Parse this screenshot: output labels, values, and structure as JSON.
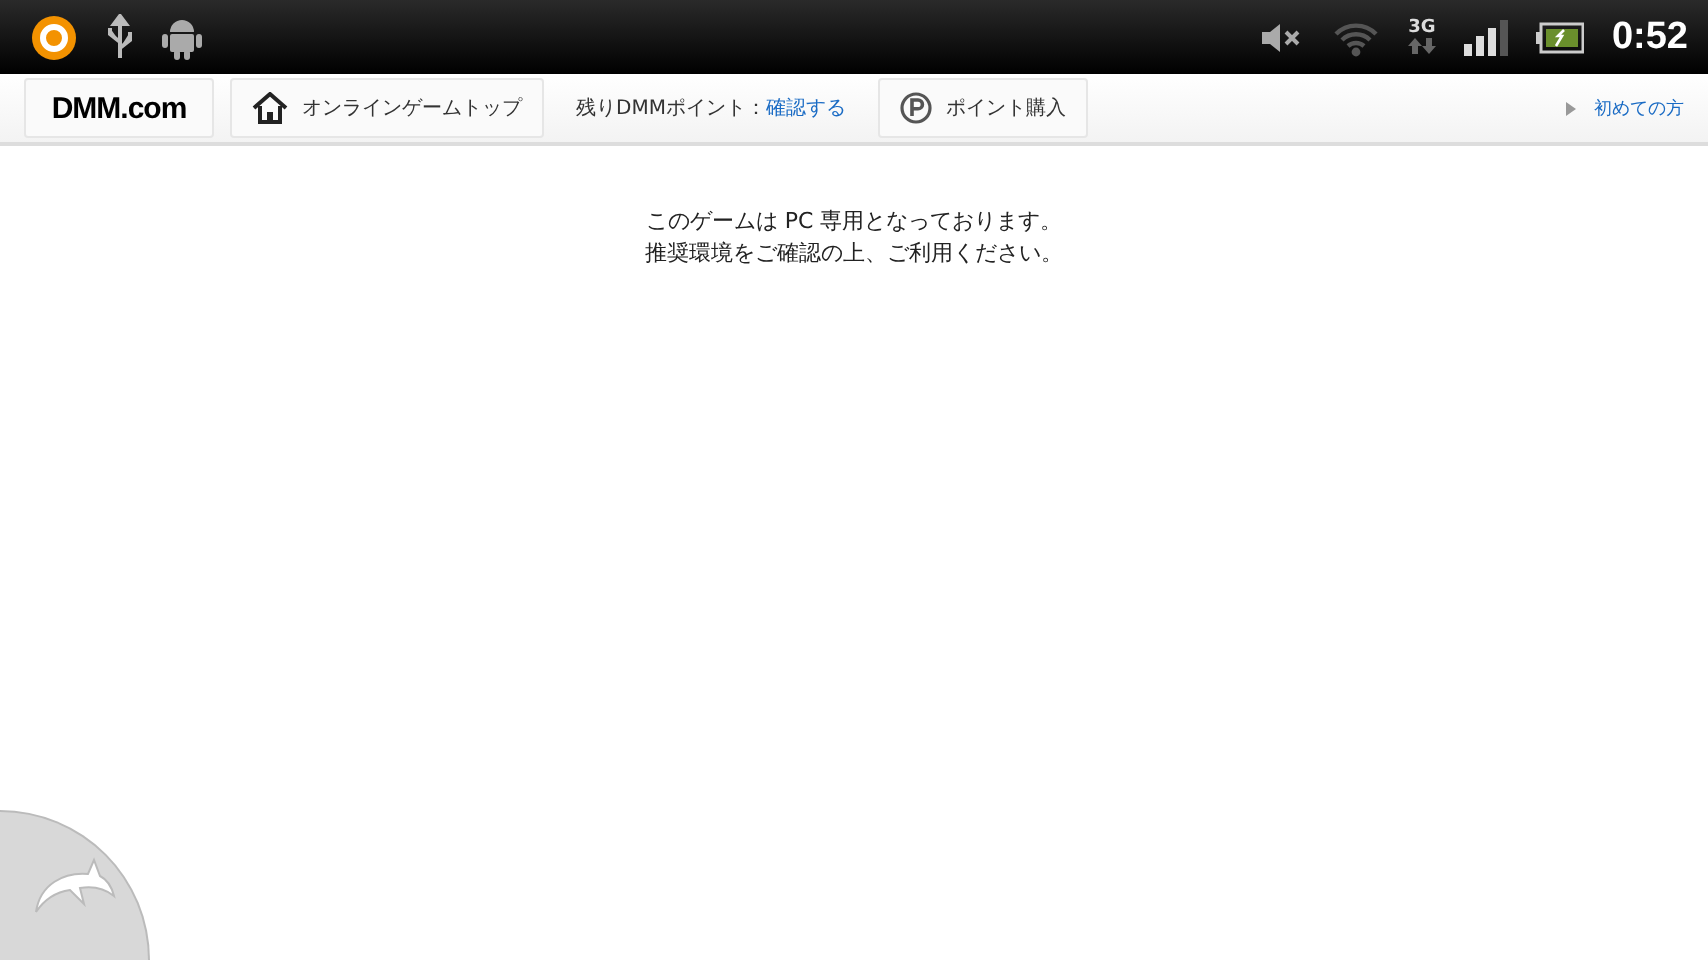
{
  "status_bar": {
    "network_label": "3G",
    "time": "0:52"
  },
  "nav": {
    "logo": "DMM.com",
    "home_link": "オンラインゲームトップ",
    "points_label": "残りDMMポイント：",
    "points_link": "確認する",
    "buy_button": "ポイント購入",
    "first_time_link": "初めての方"
  },
  "message": [
    "このゲームは PC 専用となっております。",
    "推奨環境をご確認の上、ご利用ください。"
  ]
}
